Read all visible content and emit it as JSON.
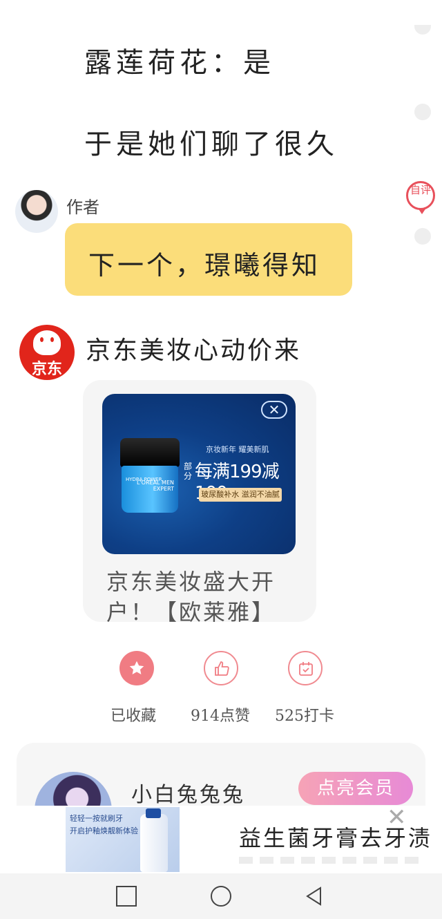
{
  "story": {
    "line1": "露莲荷花：是",
    "line2": "于是她们聊了很久"
  },
  "side": {
    "self_eval_label": "自评"
  },
  "comment": {
    "author_label": "作者",
    "bubble_text": "下一个，璟曦得知"
  },
  "ad": {
    "brand_logo_text": "京东",
    "title": "京东美妆心动价来",
    "image": {
      "sub": "京妆新年 耀美新肌",
      "badge": "部分",
      "promo": "每满199减100",
      "tag": "玻尿酸补水 滋润不油腻",
      "jar_label": "HYDRA POWER",
      "jar_brand": "L'ORÉAL MEN EXPERT",
      "close": "✕"
    },
    "caption": "京东美妆盛大开户！【欧莱雅】"
  },
  "actions": [
    {
      "label": "已收藏",
      "icon": "star-icon"
    },
    {
      "label": "914点赞",
      "icon": "thumbs-up-icon"
    },
    {
      "label": "525打卡",
      "icon": "calendar-check-icon"
    }
  ],
  "member": {
    "name": "小白兔兔兔",
    "button_label": "点亮会员"
  },
  "bottom_ad": {
    "image_line1": "轻轻一按就刷牙",
    "image_line2": "开启护釉焕靓新体验",
    "title": "益生菌牙膏去牙渍",
    "close": "✕"
  },
  "colors": {
    "bubble": "#fbdd7a",
    "accent": "#f07c83",
    "jd_red": "#e1251b"
  }
}
